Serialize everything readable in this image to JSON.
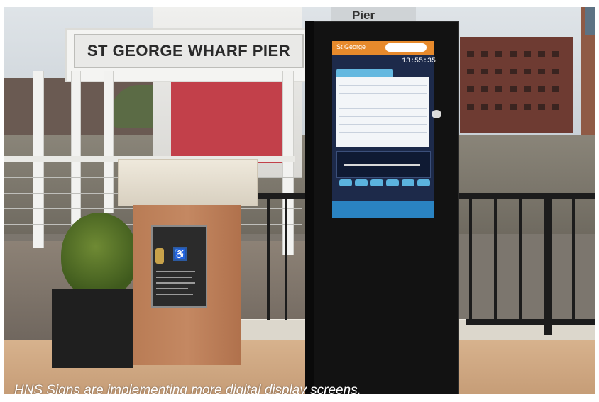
{
  "photo": {
    "pier_sign_text": "ST GEORGE WHARF PIER",
    "tower_sign_text": "Pier",
    "display": {
      "header_title": "St George",
      "clock": "13:55:35",
      "colors": {
        "header": "#e78a2c",
        "screen_bg": "#1d2a4a",
        "table_tab": "#64b8e0",
        "footer": "#2a83c2"
      }
    },
    "icons": {
      "accessibility": "wheelchair-icon"
    }
  },
  "caption": "HNS Signs are implementing more digital display screens."
}
